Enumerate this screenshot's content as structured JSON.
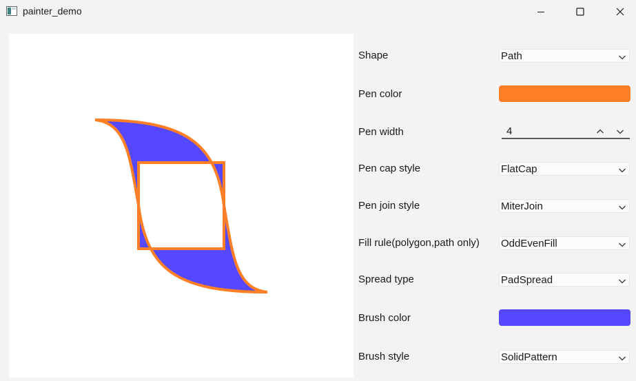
{
  "window": {
    "title": "painter_demo",
    "icon": "app-window-icon",
    "controls": [
      "minimize-icon",
      "maximize-icon",
      "close-icon"
    ]
  },
  "canvas": {
    "shape": "path",
    "pen_color": "#ff7f27",
    "brush_color": "#5548ff"
  },
  "controls": {
    "shape": {
      "label": "Shape",
      "value": "Path"
    },
    "pen_color": {
      "label": "Pen color",
      "color": "#ff7f27"
    },
    "pen_width": {
      "label": "Pen width",
      "value": "4"
    },
    "pen_cap_style": {
      "label": "Pen cap style",
      "value": "FlatCap"
    },
    "pen_join_style": {
      "label": "Pen join style",
      "value": "MiterJoin"
    },
    "fill_rule": {
      "label": "Fill rule(polygon,path only)",
      "value": "OddEvenFill"
    },
    "spread_type": {
      "label": "Spread type",
      "value": "PadSpread"
    },
    "brush_color": {
      "label": "Brush color",
      "color": "#5548ff"
    },
    "brush_style": {
      "label": "Brush style",
      "value": "SolidPattern"
    }
  }
}
